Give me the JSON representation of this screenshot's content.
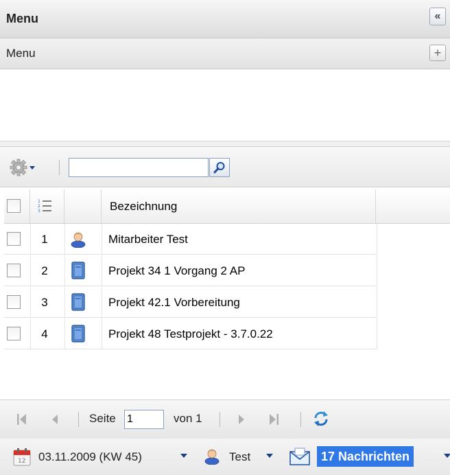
{
  "panel": {
    "title": "Menu",
    "collapse_icon": "«"
  },
  "menu_section": {
    "label": "Menu",
    "add_icon": "+"
  },
  "toolbar": {
    "search_value": "",
    "gear_icon": "gear-icon",
    "search_icon": "magnifier-icon"
  },
  "grid": {
    "columns": [
      "",
      "",
      "",
      "Bezeichnung"
    ],
    "rows": [
      {
        "num": "1",
        "icon": "user-icon",
        "name": "Mitarbeiter Test"
      },
      {
        "num": "2",
        "icon": "project-book-icon",
        "name": "Projekt 34 1 Vorgang 2 AP"
      },
      {
        "num": "3",
        "icon": "project-book-icon",
        "name": "Projekt 42.1 Vorbereitung"
      },
      {
        "num": "4",
        "icon": "project-book-icon",
        "name": "Projekt 48 Testprojekt - 3.7.0.22"
      }
    ]
  },
  "paging": {
    "page_label": "Seite",
    "page_value": "1",
    "of_label": "von 1"
  },
  "status": {
    "date": "03.11.2009 (KW 45)",
    "user": "Test",
    "messages": "17 Nachrichten",
    "accent": "#2f78e6"
  }
}
